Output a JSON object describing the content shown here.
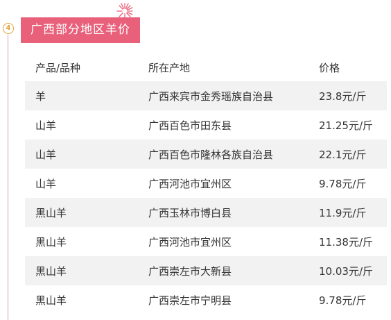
{
  "section": {
    "step_number": "4",
    "title": "广西部分地区羊价"
  },
  "table": {
    "headers": [
      "产品/品种",
      "所在产地",
      "价格"
    ],
    "rows": [
      {
        "product": "羊",
        "origin": "广西来宾市金秀瑶族自治县",
        "price": "23.8元/斤"
      },
      {
        "product": "山羊",
        "origin": "广西百色市田东县",
        "price": "21.25元/斤"
      },
      {
        "product": "山羊",
        "origin": "广西百色市隆林各族自治县",
        "price": "22.1元/斤"
      },
      {
        "product": "山羊",
        "origin": "广西河池市宜州区",
        "price": "9.78元/斤"
      },
      {
        "product": "黑山羊",
        "origin": "广西玉林市博白县",
        "price": "11.9元/斤"
      },
      {
        "product": "黑山羊",
        "origin": "广西河池市宜州区",
        "price": "11.38元/斤"
      },
      {
        "product": "黑山羊",
        "origin": "广西崇左市大新县",
        "price": "10.03元/斤"
      },
      {
        "product": "黑山羊",
        "origin": "广西崇左市宁明县",
        "price": "9.78元/斤"
      }
    ]
  },
  "colors": {
    "title_background": "#e8607a",
    "badge_accent": "#e2a23b",
    "shaded_row": "#f2f2f2"
  },
  "icons": {
    "sparkle": "firework-sparkle-icon"
  }
}
